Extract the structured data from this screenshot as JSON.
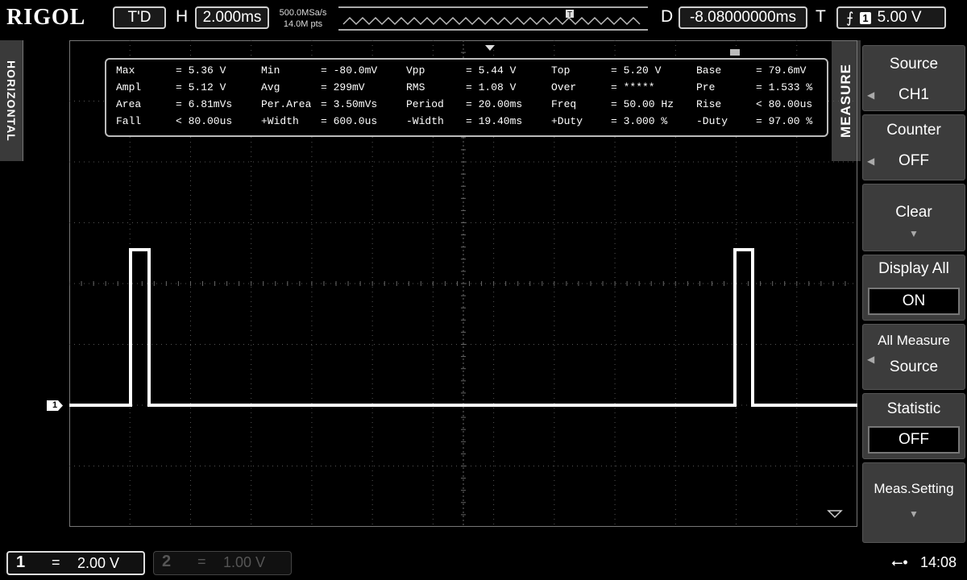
{
  "brand": "RIGOL",
  "top": {
    "run_status": "T'D",
    "horizontal_label": "H",
    "timebase": "2.000ms",
    "sample_rate": "500.0MSa/s",
    "memory_depth": "14.0M pts",
    "delay_label": "D",
    "delay": "-8.08000000ms",
    "trigger_label": "T",
    "trigger_channel": "1",
    "trigger_level": "5.00 V"
  },
  "side_tabs": {
    "horizontal": "HORIZONTAL",
    "measure": "MEASURE"
  },
  "measurements": [
    [
      {
        "name": "Max",
        "value": "= 5.36 V"
      },
      {
        "name": "Min",
        "value": "= -80.0mV"
      },
      {
        "name": "Vpp",
        "value": "= 5.44 V"
      },
      {
        "name": "Top",
        "value": "= 5.20 V"
      },
      {
        "name": "Base",
        "value": "= 79.6mV"
      }
    ],
    [
      {
        "name": "Ampl",
        "value": "= 5.12 V"
      },
      {
        "name": "Avg",
        "value": "= 299mV"
      },
      {
        "name": "RMS",
        "value": "= 1.08 V"
      },
      {
        "name": "Over",
        "value": "= *****"
      },
      {
        "name": "Pre",
        "value": "= 1.533 %"
      }
    ],
    [
      {
        "name": "Area",
        "value": "= 6.81mVs"
      },
      {
        "name": "Per.Area",
        "value": "= 3.50mVs"
      },
      {
        "name": "Period",
        "value": "= 20.00ms"
      },
      {
        "name": "Freq",
        "value": "= 50.00 Hz"
      },
      {
        "name": "Rise",
        "value": "< 80.00us"
      }
    ],
    [
      {
        "name": "Fall",
        "value": "< 80.00us"
      },
      {
        "name": "+Width",
        "value": "= 600.0us"
      },
      {
        "name": "-Width",
        "value": "= 19.40ms"
      },
      {
        "name": "+Duty",
        "value": "= 3.000 %"
      },
      {
        "name": "-Duty",
        "value": "= 97.00 %"
      }
    ]
  ],
  "menu": {
    "source_title": "Source",
    "source_value": "CH1",
    "counter_title": "Counter",
    "counter_value": "OFF",
    "clear_title": "Clear",
    "display_all_title": "Display All",
    "display_all_value": "ON",
    "all_measure_title_1": "All Measure",
    "all_measure_title_2": "Source",
    "statistic_title": "Statistic",
    "statistic_value": "OFF",
    "meas_setting_title": "Meas.Setting"
  },
  "channel_marker": "1",
  "bottom": {
    "ch1_num": "1",
    "ch1_coupling": "=",
    "ch1_scale": "2.00 V",
    "ch2_num": "2",
    "ch2_coupling": "=",
    "ch2_scale": "1.00 V",
    "time": "14:08"
  },
  "icons": {
    "usb": "usb-icon",
    "trigger_edge": "rising-edge-icon"
  },
  "colors": {
    "background": "#000000",
    "trace": "#ffffff",
    "grid": "#666666",
    "menu": "#3c3c3c"
  }
}
